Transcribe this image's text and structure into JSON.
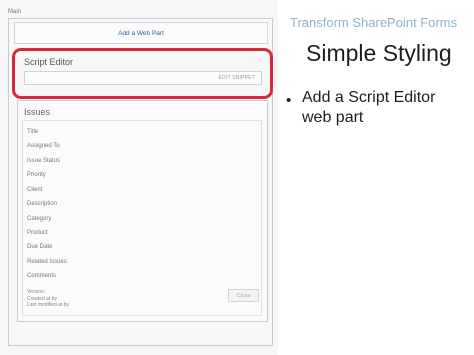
{
  "sharepoint_page": {
    "zone_label": "Main",
    "add_web_part": "Add a Web Part",
    "script_editor": {
      "title": "Script Editor",
      "edit_snippet": "EDIT SNIPPET"
    },
    "issues_form": {
      "title": "Issues",
      "fields": [
        "Title",
        "Assigned To",
        "Issue Status",
        "Priority",
        "Client",
        "Description",
        "Category",
        "Product",
        "Due Date",
        "Related Issues",
        "Comments"
      ],
      "metadata": [
        "Version:",
        "Created at by",
        "Last modified at by"
      ],
      "close_label": "Close"
    }
  },
  "slide": {
    "header": "Transform SharePoint Forms",
    "title": "Simple Styling",
    "bullet_symbol": "•",
    "bullets": [
      "Add a Script Editor web part"
    ]
  },
  "colors": {
    "highlight": "#d8283b",
    "header_text": "#8fb3c6",
    "link": "#2a5f9e"
  }
}
